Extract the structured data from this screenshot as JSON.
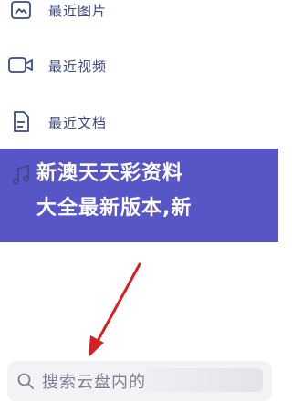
{
  "menu": {
    "items": [
      {
        "label": "最近图片",
        "icon": "image-icon"
      },
      {
        "label": "最近视频",
        "icon": "video-icon"
      },
      {
        "label": "最近文档",
        "icon": "document-icon"
      },
      {
        "label": "",
        "icon": "music-icon"
      }
    ]
  },
  "banner": {
    "line1": "新澳天天彩资料",
    "line2": "大全最新版本,新"
  },
  "search": {
    "placeholder": "搜索云盘内的"
  },
  "colors": {
    "accent": "#3b4a86",
    "banner": "#5855c6",
    "annotation_arrow": "#d42020"
  }
}
